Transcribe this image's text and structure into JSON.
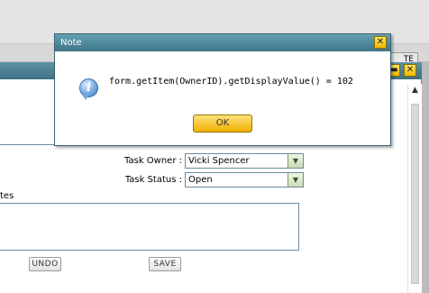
{
  "background": {
    "tab_fragment": "TE"
  },
  "inner_window": {
    "minimize_symbol": "▬",
    "close_symbol": "✕"
  },
  "form": {
    "task_owner_label": "Task Owner :",
    "task_owner_value": "Vicki Spencer",
    "task_status_label": "Task Status :",
    "task_status_value": "Open",
    "notes_label": "tes :",
    "undo_label": "UNDO",
    "save_label": "SAVE",
    "scroll_up_symbol": "▲",
    "dropdown_arrow": "▼"
  },
  "dialog": {
    "title": "Note",
    "close_symbol": "✕",
    "icon_glyph": "i",
    "message": "form.getItem(OwnerID).getDisplayValue() = 102",
    "ok_label": "OK"
  },
  "colors": {
    "title_bar": "#4f8295",
    "ok_button": "#f4c01e",
    "window_control": "#f6c80c"
  }
}
